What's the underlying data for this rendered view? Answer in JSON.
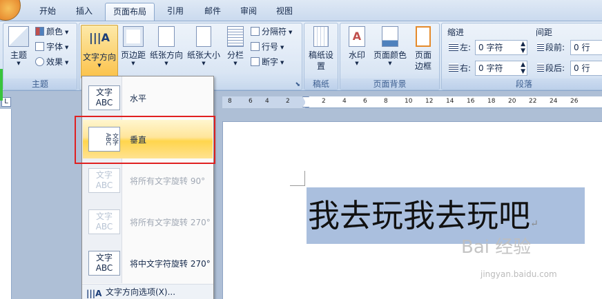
{
  "tabs": {
    "items": [
      "开始",
      "插入",
      "页面布局",
      "引用",
      "邮件",
      "审阅",
      "视图"
    ],
    "active": "页面布局"
  },
  "theme_group": {
    "label": "主题",
    "theme_btn": "主题",
    "colors": "颜色",
    "fonts": "字体",
    "effects": "效果"
  },
  "page_setup": {
    "text_direction": "文字方向",
    "margins": "页边距",
    "orientation": "纸张方向",
    "size": "纸张大小",
    "columns": "分栏",
    "breaks": "分隔符",
    "line_numbers": "行号",
    "hyphenation": "断字"
  },
  "draft_group": {
    "label": "稿纸",
    "btn": "稿纸设置"
  },
  "background_group": {
    "label": "页面背景",
    "watermark": "水印",
    "page_color": "页面颜色",
    "page_borders": "页面边框"
  },
  "paragraph_group": {
    "label": "段落",
    "indent_title": "缩进",
    "spacing_title": "间距",
    "left_label": "左:",
    "right_label": "右:",
    "left_value": "0 字符",
    "right_value": "0 字符",
    "before_label": "段前:",
    "after_label": "段后:",
    "before_value": "0 行",
    "after_value": "0 行"
  },
  "ruler": {
    "ticks": [
      "8",
      "6",
      "4",
      "2",
      "2",
      "4",
      "6",
      "8",
      "10",
      "12",
      "14",
      "16",
      "18",
      "20",
      "22",
      "24",
      "26"
    ]
  },
  "menu": {
    "items": [
      {
        "icon_text": "文字 ABC",
        "label": "水平",
        "enabled": true
      },
      {
        "icon_text": "文字ABC",
        "label": "垂直",
        "enabled": true,
        "highlighted": true
      },
      {
        "icon_text": "文字 ABC",
        "label": "将所有文字旋转 90°",
        "enabled": false
      },
      {
        "icon_text": "文字 ABC",
        "label": "将所有文字旋转 270°",
        "enabled": false
      },
      {
        "icon_text": "文字 ABC",
        "label": "将中文字符旋转 270°",
        "enabled": true
      }
    ],
    "footer": "文字方向选项(X)..."
  },
  "document": {
    "text": "我去玩我去玩吧",
    "pilcrow": "↵"
  },
  "watermark": {
    "brand": "Bai 经验",
    "url": "jingyan.baidu.com"
  }
}
